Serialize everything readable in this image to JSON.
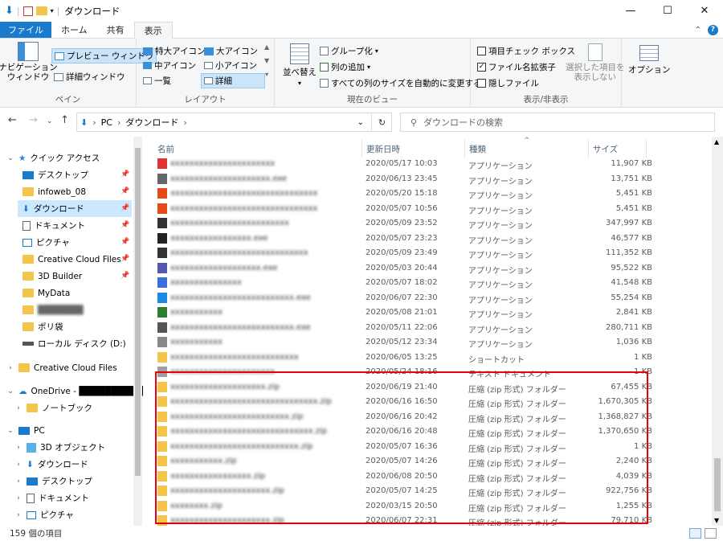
{
  "window": {
    "title": "ダウンロード",
    "controls": [
      "minimize",
      "maximize",
      "close"
    ]
  },
  "ribbon": {
    "tabs": [
      "ファイル",
      "ホーム",
      "共有",
      "表示"
    ],
    "active_tab": "表示",
    "groups": {
      "pane": {
        "label": "ペイン",
        "nav_pane": "ナビゲーション\nウィンドウ",
        "preview": "プレビュー ウィンドウ",
        "details": "詳細ウィンドウ"
      },
      "layout": {
        "label": "レイアウト",
        "xl_icons": "特大アイコン",
        "l_icons": "大アイコン",
        "m_icons": "中アイコン",
        "s_icons": "小アイコン",
        "list": "一覧",
        "details": "詳細"
      },
      "current_view": {
        "label": "現在のビュー",
        "sort": "並べ替え",
        "group": "グループ化",
        "add_col": "列の追加",
        "fit_cols": "すべての列のサイズを自動的に変更する"
      },
      "show_hide": {
        "label": "表示/非表示",
        "item_checkbox": "項目チェック ボックス",
        "extensions": "ファイル名拡張子",
        "hidden": "隠しファイル",
        "hide_selected": "選択した項目を\n表示しない"
      },
      "options": "オプション"
    }
  },
  "address": {
    "path": [
      "PC",
      "ダウンロード"
    ],
    "search_placeholder": "ダウンロードの検索"
  },
  "nav": {
    "items": [
      {
        "label": "クイック アクセス",
        "icon": "star-icon"
      },
      {
        "label": "デスクトップ",
        "icon": "desktop-icon"
      },
      {
        "label": "infoweb_08",
        "icon": "folder-icon"
      },
      {
        "label": "ダウンロード",
        "icon": "download-icon"
      },
      {
        "label": "ドキュメント",
        "icon": "document-icon"
      },
      {
        "label": "ピクチャ",
        "icon": "pictures-icon"
      },
      {
        "label": "Creative Cloud Files",
        "icon": "folder-icon"
      },
      {
        "label": "3D Builder",
        "icon": "folder-icon"
      },
      {
        "label": "MyData",
        "icon": "folder-icon"
      },
      {
        "label": "███████",
        "icon": "folder-icon"
      },
      {
        "label": "ポリ袋",
        "icon": "folder-icon"
      },
      {
        "label": "ローカル ディスク (D:)",
        "icon": "drive-icon"
      },
      {
        "label": "Creative Cloud Files",
        "icon": "cloud-icon"
      },
      {
        "label": "OneDrive - ██████████",
        "icon": "onedrive-icon"
      },
      {
        "label": "ノートブック",
        "icon": "folder-icon"
      },
      {
        "label": "PC",
        "icon": "pc-icon"
      },
      {
        "label": "3D オブジェクト",
        "icon": "3d-icon"
      },
      {
        "label": "ダウンロード",
        "icon": "download-icon"
      },
      {
        "label": "デスクトップ",
        "icon": "desktop-icon"
      },
      {
        "label": "ドキュメント",
        "icon": "document-icon"
      },
      {
        "label": "ピクチャ",
        "icon": "pictures-icon"
      }
    ]
  },
  "columns": {
    "name": "名前",
    "date": "更新日時",
    "type": "種類",
    "size": "サイズ"
  },
  "files": [
    {
      "name": "xxxxxxxxxxxxxxxxxxxxxx",
      "date": "2020/05/17 10:03",
      "type": "アプリケーション",
      "size": "11,907 KB",
      "icon": "#d33"
    },
    {
      "name": "xxxxxxxxxxxxxxxxxxxxx.exe",
      "date": "2020/06/13 23:45",
      "type": "アプリケーション",
      "size": "13,751 KB",
      "icon": "#666"
    },
    {
      "name": "xxxxxxxxxxxxxxxxxxxxxxxxxxxxxxx",
      "date": "2020/05/20 15:18",
      "type": "アプリケーション",
      "size": "5,451 KB",
      "icon": "#e64a19"
    },
    {
      "name": "xxxxxxxxxxxxxxxxxxxxxxxxxxxxxxx",
      "date": "2020/05/07 10:56",
      "type": "アプリケーション",
      "size": "5,451 KB",
      "icon": "#e64a19"
    },
    {
      "name": "xxxxxxxxxxxxxxxxxxxxxxxxx",
      "date": "2020/05/09 23:52",
      "type": "アプリケーション",
      "size": "347,997 KB",
      "icon": "#333"
    },
    {
      "name": "xxxxxxxxxxxxxxxxx.exe",
      "date": "2020/05/07 23:23",
      "type": "アプリケーション",
      "size": "46,577 KB",
      "icon": "#222"
    },
    {
      "name": "xxxxxxxxxxxxxxxxxxxxxxxxxxxxx",
      "date": "2020/05/09 23:49",
      "type": "アプリケーション",
      "size": "111,352 KB",
      "icon": "#333"
    },
    {
      "name": "xxxxxxxxxxxxxxxxxxx.exe",
      "date": "2020/05/03 20:44",
      "type": "アプリケーション",
      "size": "95,522 KB",
      "icon": "#5558af"
    },
    {
      "name": "xxxxxxxxxxxxxxx",
      "date": "2020/05/07 18:02",
      "type": "アプリケーション",
      "size": "41,548 KB",
      "icon": "#3a6fd8"
    },
    {
      "name": "xxxxxxxxxxxxxxxxxxxxxxxxxx.exe",
      "date": "2020/06/07 22:30",
      "type": "アプリケーション",
      "size": "55,254 KB",
      "icon": "#1e88e5"
    },
    {
      "name": "xxxxxxxxxxx",
      "date": "2020/05/08 21:01",
      "type": "アプリケーション",
      "size": "2,841 KB",
      "icon": "#2e7d32"
    },
    {
      "name": "xxxxxxxxxxxxxxxxxxxxxxxxxx.exe",
      "date": "2020/05/11 22:06",
      "type": "アプリケーション",
      "size": "280,711 KB",
      "icon": "#555"
    },
    {
      "name": "xxxxxxxxxxx",
      "date": "2020/05/12 23:34",
      "type": "アプリケーション",
      "size": "1,036 KB",
      "icon": "#888"
    },
    {
      "name": "xxxxxxxxxxxxxxxxxxxxxxxxxxx",
      "date": "2020/06/05 13:25",
      "type": "ショートカット",
      "size": "1 KB",
      "icon": "#f3c54b"
    },
    {
      "name": "xxxxxxxxxxxxxxxxxxxxxx",
      "date": "2020/05/24 18:16",
      "type": "テキスト ドキュメント",
      "size": "1 KB",
      "icon": "#9e9e9e"
    },
    {
      "name": "xxxxxxxxxxxxxxxxxxxx.zip",
      "date": "2020/06/19 21:40",
      "type": "圧縮 (zip 形式) フォルダー",
      "size": "67,455 KB",
      "icon": "#f3c54b"
    },
    {
      "name": "xxxxxxxxxxxxxxxxxxxxxxxxxxxxxxx.zip",
      "date": "2020/06/16 16:50",
      "type": "圧縮 (zip 形式) フォルダー",
      "size": "1,670,305 KB",
      "icon": "#f3c54b"
    },
    {
      "name": "xxxxxxxxxxxxxxxxxxxxxxxxx.zip",
      "date": "2020/06/16 20:42",
      "type": "圧縮 (zip 形式) フォルダー",
      "size": "1,368,827 KB",
      "icon": "#f3c54b"
    },
    {
      "name": "xxxxxxxxxxxxxxxxxxxxxxxxxxxxxx.zip",
      "date": "2020/06/16 20:48",
      "type": "圧縮 (zip 形式) フォルダー",
      "size": "1,370,650 KB",
      "icon": "#f3c54b"
    },
    {
      "name": "xxxxxxxxxxxxxxxxxxxxxxxxxxx.zip",
      "date": "2020/05/07 16:36",
      "type": "圧縮 (zip 形式) フォルダー",
      "size": "1 KB",
      "icon": "#f3c54b"
    },
    {
      "name": "xxxxxxxxxxx.zip",
      "date": "2020/05/07 14:26",
      "type": "圧縮 (zip 形式) フォルダー",
      "size": "2,240 KB",
      "icon": "#f3c54b"
    },
    {
      "name": "xxxxxxxxxxxxxxxxx.zip",
      "date": "2020/06/08 20:50",
      "type": "圧縮 (zip 形式) フォルダー",
      "size": "4,039 KB",
      "icon": "#f3c54b"
    },
    {
      "name": "xxxxxxxxxxxxxxxxxxxxx.zip",
      "date": "2020/05/07 14:25",
      "type": "圧縮 (zip 形式) フォルダー",
      "size": "922,756 KB",
      "icon": "#f3c54b"
    },
    {
      "name": "xxxxxxxx.zip",
      "date": "2020/03/15 20:50",
      "type": "圧縮 (zip 形式) フォルダー",
      "size": "1,255 KB",
      "icon": "#f3c54b"
    },
    {
      "name": "xxxxxxxxxxxxxxxxxxxxx.zip",
      "date": "2020/06/07 22:31",
      "type": "圧縮 (zip 形式) フォルダー",
      "size": "79,710 KB",
      "icon": "#f3c54b"
    }
  ],
  "status": {
    "count_text": "159 個の項目"
  },
  "colors": {
    "file_tab": "#1979ca",
    "highlight": "#e8000b",
    "selected": "#cce8ff"
  }
}
